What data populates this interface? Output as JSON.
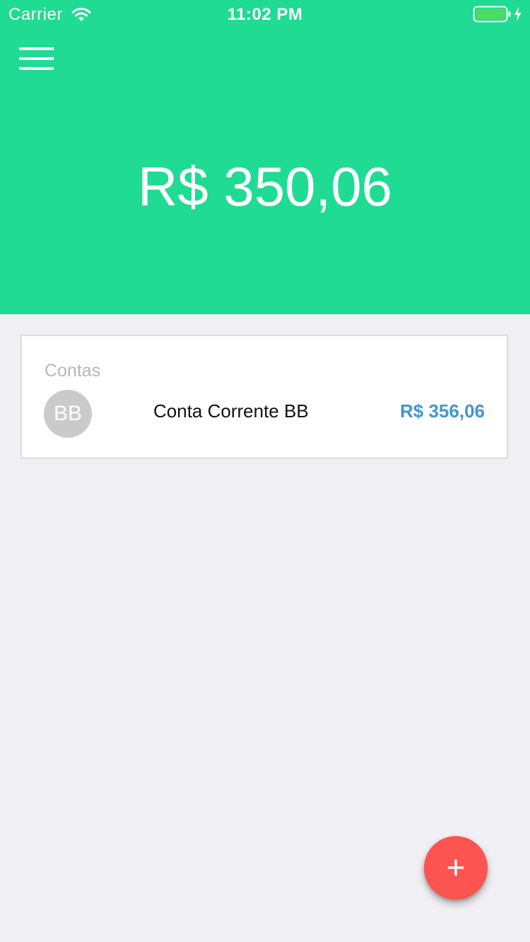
{
  "status_bar": {
    "carrier": "Carrier",
    "time": "11:02 PM"
  },
  "header": {
    "menu_icon": "hamburger-menu-icon",
    "balance": "R$ 350,06"
  },
  "accounts_card": {
    "title": "Contas",
    "items": [
      {
        "initials": "BB",
        "name": "Conta Corrente BB",
        "amount": "R$ 356,06"
      }
    ]
  },
  "fab": {
    "label": "+",
    "icon": "plus-icon"
  },
  "colors": {
    "header_green": "#1fdb93",
    "background": "#efeff4",
    "amount_blue": "#3f97d3",
    "fab_red": "#fc5451",
    "avatar_gray": "#cacaca"
  }
}
